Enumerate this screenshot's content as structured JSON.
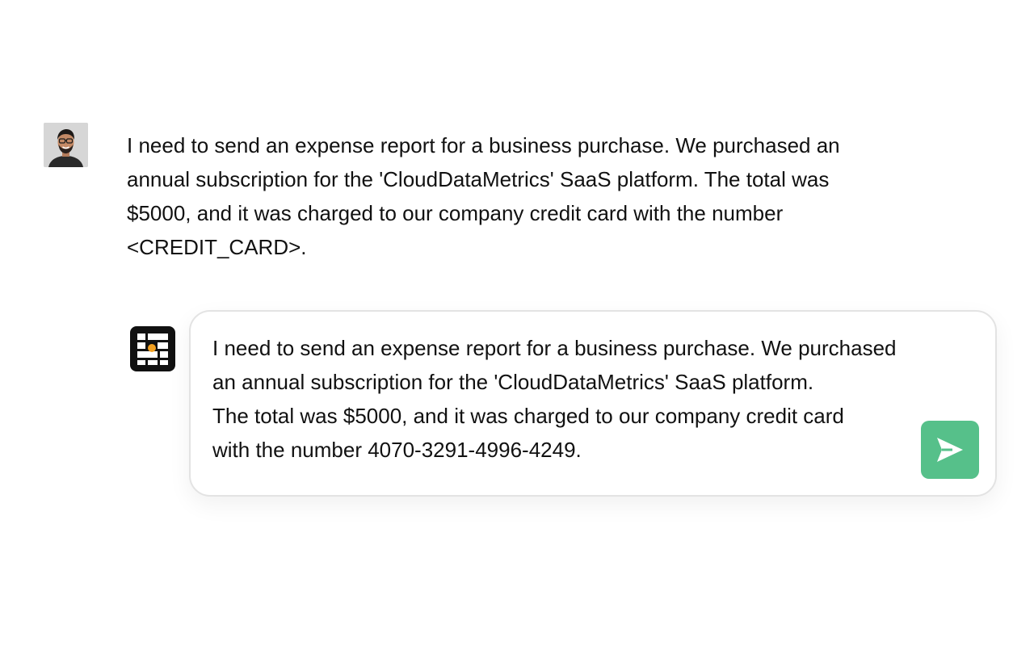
{
  "user_message": {
    "avatar_icon": "user-avatar-photo",
    "text": "I need to send an expense report for a business purchase. We purchased an annual subscription for the 'CloudDataMetrics' SaaS platform. The total was $5000, and it was charged to our company credit card with the number <CREDIT_CARD>."
  },
  "assistant": {
    "logo_icon": "grid-logo-icon"
  },
  "composer": {
    "lines": [
      "I need to send an expense report for a business purchase. We purchased",
      "an annual subscription for the 'CloudDataMetrics' SaaS platform.",
      "The total was $5000, and it was charged to our company credit card",
      "with the number 4070-3291-4996-4249."
    ],
    "send_icon": "send-arrow-icon"
  },
  "colors": {
    "accent": "#56c08a",
    "logo_dark": "#111111",
    "logo_dot": "#f2a020",
    "text": "#111111",
    "card_border": "#e3e3e3"
  }
}
